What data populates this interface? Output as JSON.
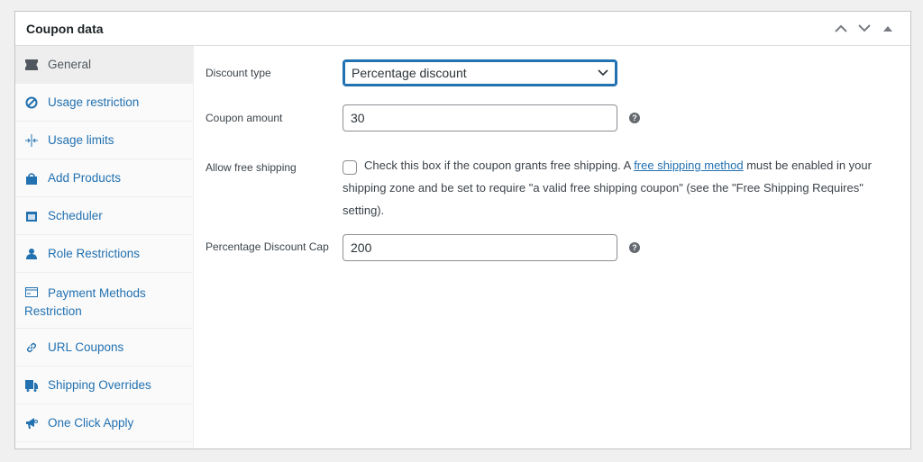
{
  "panel": {
    "title": "Coupon data",
    "controls": [
      "move-up",
      "move-down",
      "toggle"
    ]
  },
  "sidebar": {
    "items": [
      {
        "label": "General",
        "icon": "ticket-icon",
        "active": true
      },
      {
        "label": "Usage restriction",
        "icon": "ban-icon"
      },
      {
        "label": "Usage limits",
        "icon": "limits-icon"
      },
      {
        "label": "Add Products",
        "icon": "bag-icon"
      },
      {
        "label": "Scheduler",
        "icon": "calendar-icon"
      },
      {
        "label": "Role Restrictions",
        "icon": "user-icon"
      },
      {
        "label": "Payment Methods Restriction",
        "icon": "card-icon"
      },
      {
        "label": "URL Coupons",
        "icon": "link-icon"
      },
      {
        "label": "Shipping Overrides",
        "icon": "truck-icon"
      },
      {
        "label": "One Click Apply",
        "icon": "megaphone-icon"
      }
    ]
  },
  "general": {
    "discount_type": {
      "label": "Discount type",
      "value": "Percentage discount"
    },
    "coupon_amount": {
      "label": "Coupon amount",
      "value": "30"
    },
    "free_shipping": {
      "label": "Allow free shipping",
      "checked": false,
      "desc_before": "Check this box if the coupon grants free shipping. A ",
      "link": "free shipping method",
      "desc_after": " must be enabled in your shipping zone and be set to require \"a valid free shipping coupon\" (see the \"Free Shipping Requires\" setting)."
    },
    "cap": {
      "label": "Percentage Discount Cap",
      "value": "200"
    }
  },
  "colors": {
    "accent": "#2271b1"
  }
}
